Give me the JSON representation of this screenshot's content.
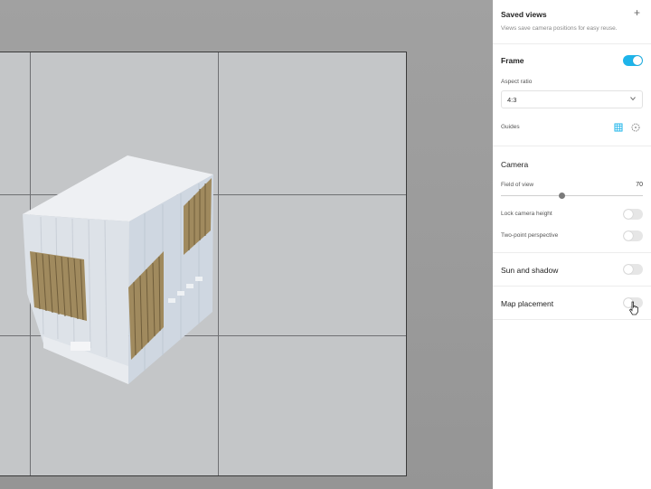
{
  "panel": {
    "saved_views": {
      "title": "Saved views",
      "description": "Views save camera positions for easy reuse.",
      "add_icon": "plus-icon"
    },
    "frame": {
      "title": "Frame",
      "enabled": true,
      "aspect_ratio_label": "Aspect ratio",
      "aspect_ratio_value": "4:3",
      "guides_label": "Guides",
      "guide_icons": [
        "grid-icon",
        "circle-guide-icon"
      ]
    },
    "camera": {
      "title": "Camera",
      "fov_label": "Field of view",
      "fov_value": "70",
      "lock_height_label": "Lock camera height",
      "lock_height_enabled": false,
      "two_point_label": "Two-point perspective",
      "two_point_enabled": false
    },
    "sun": {
      "title": "Sun and shadow",
      "enabled": false
    },
    "map": {
      "title": "Map placement",
      "enabled": false
    }
  },
  "colors": {
    "accent": "#1eb4ea",
    "frame_bg": "#c4c6c8",
    "viewport_bg": "#9b9b9b",
    "wood": "#a08a5e"
  }
}
